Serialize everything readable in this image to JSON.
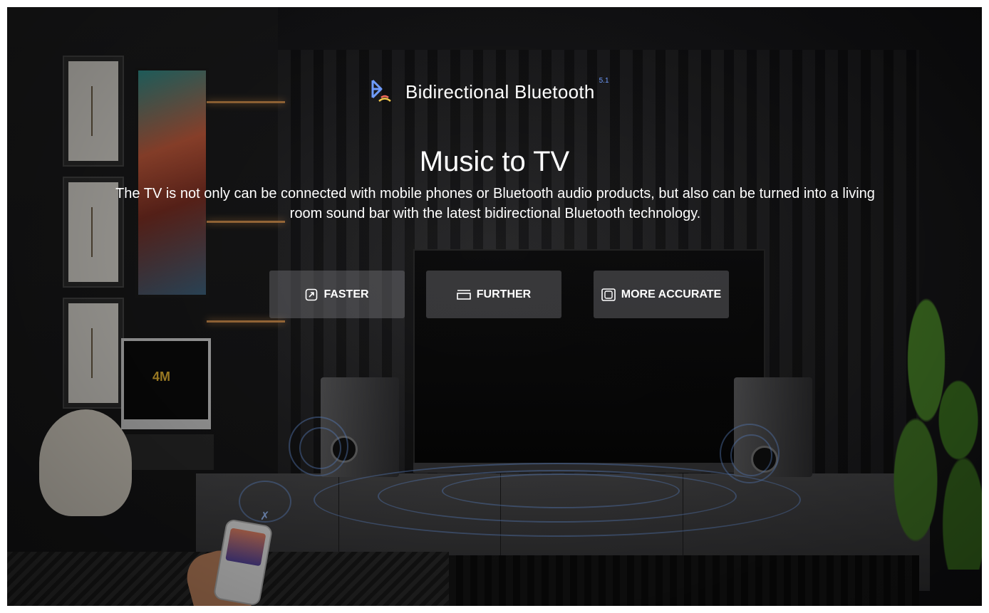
{
  "brand": {
    "icon": "bluetooth-icon",
    "label": "Bidirectional Bluetooth",
    "superscript": "5.1",
    "accent_color": "#6f9cff"
  },
  "headline": "Music to TV",
  "description": "The TV is not only can be connected with mobile phones or Bluetooth audio products, but also can be turned into a living room sound bar with the latest bidirectional Bluetooth technology.",
  "features": [
    {
      "label": "FASTER",
      "icon": "arrow-up-right-icon"
    },
    {
      "label": "FURTHER",
      "icon": "horizontal-lines-icon"
    },
    {
      "label": "MORE ACCURATE",
      "icon": "target-square-icon"
    }
  ],
  "scene": {
    "monitor_logo": "4M"
  },
  "colors": {
    "background": "#1b1b1d",
    "text": "#ffffff",
    "wave": "#78aaff",
    "feature_panel": "#78787c"
  }
}
